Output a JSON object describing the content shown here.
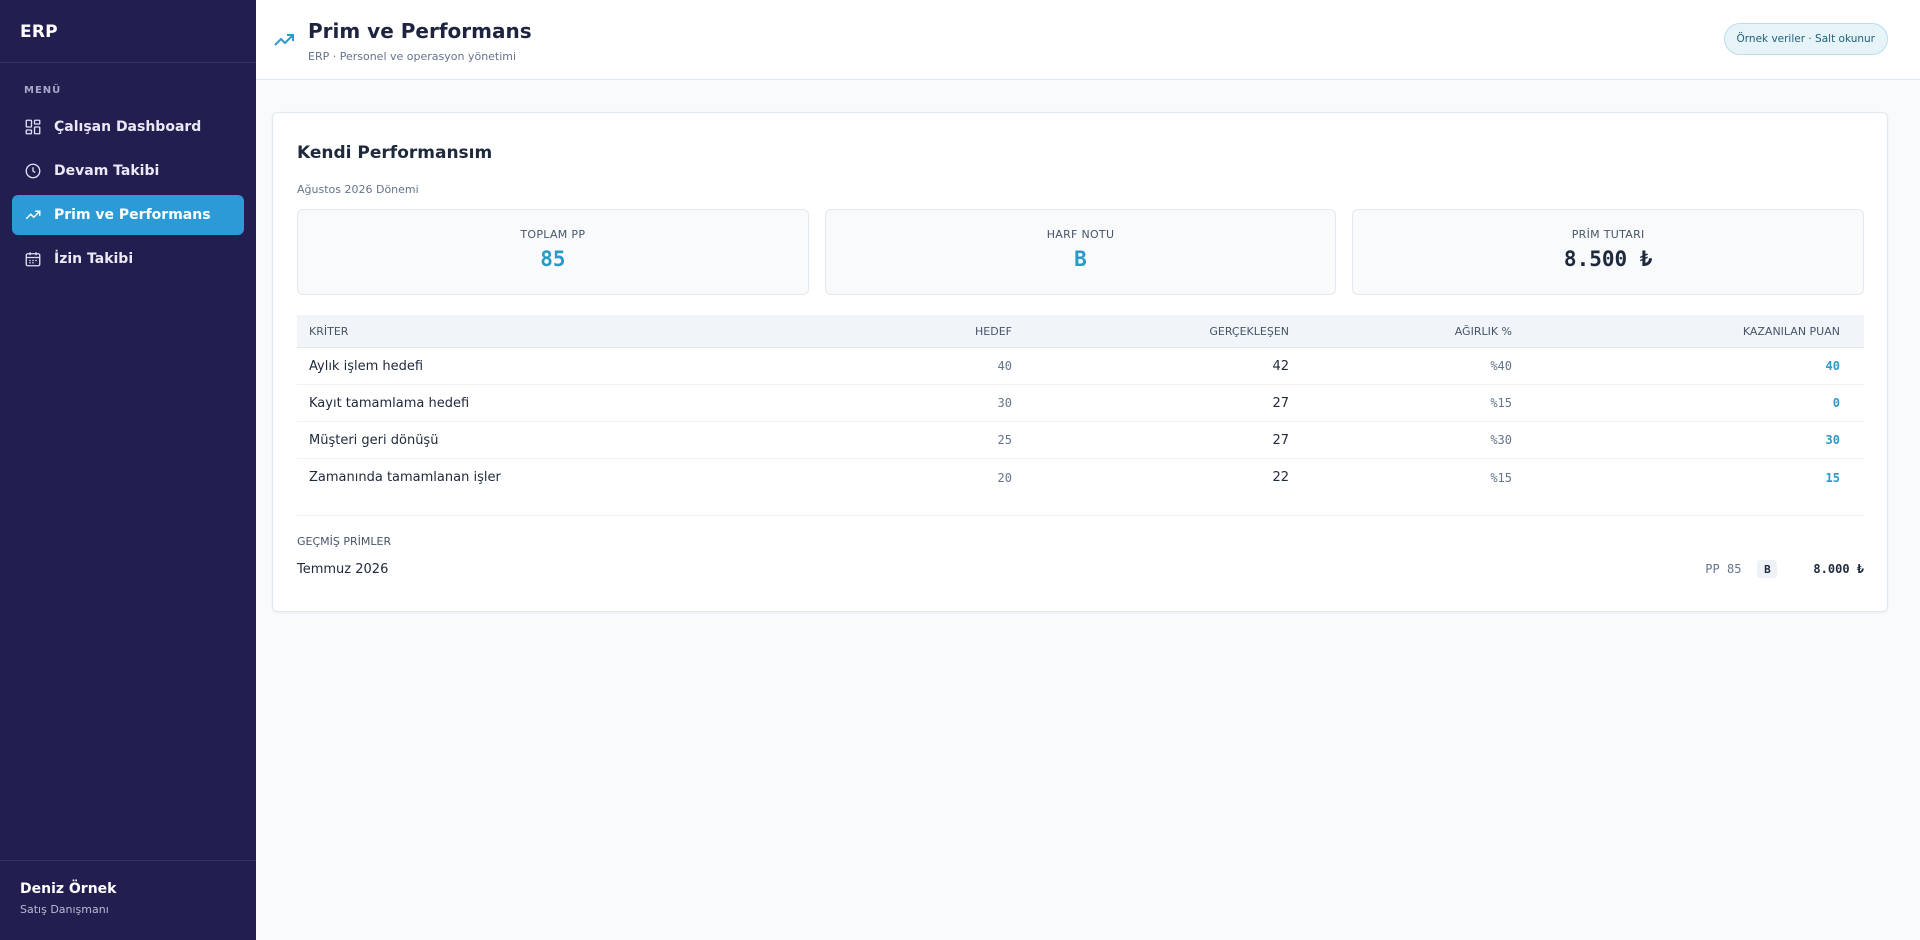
{
  "app": {
    "brand": "ERP"
  },
  "sidebar": {
    "menu_label": "MENÜ",
    "items": [
      {
        "label": "Çalışan Dashboard",
        "icon": "dashboard-icon",
        "active": false
      },
      {
        "label": "Devam Takibi",
        "icon": "clock-icon",
        "active": false
      },
      {
        "label": "Prim ve Performans",
        "icon": "trending-up-icon",
        "active": true
      },
      {
        "label": "İzin Takibi",
        "icon": "calendar-icon",
        "active": false
      }
    ],
    "user": {
      "name": "Deniz Örnek",
      "role": "Satış Danışmanı"
    }
  },
  "header": {
    "title": "Prim ve Performans",
    "subtitle": "ERP · Personel ve operasyon yönetimi",
    "badge": "Örnek veriler · Salt okunur"
  },
  "performance": {
    "title": "Kendi Performansım",
    "period": "Ağustos 2026 Dönemi",
    "stats": [
      {
        "label": "TOPLAM PP",
        "value": "85"
      },
      {
        "label": "HARF NOTU",
        "value": "B"
      },
      {
        "label": "PRİM TUTARI",
        "value": "8.500 ₺"
      }
    ],
    "table": {
      "headers": [
        "KRİTER",
        "HEDEF",
        "GERÇEKLEŞEN",
        "AĞIRLIK %",
        "KAZANILAN PUAN"
      ],
      "rows": [
        {
          "criterion": "Aylık işlem hedefi",
          "target": "40",
          "actual": "42",
          "weight": "%40",
          "points": "40"
        },
        {
          "criterion": "Kayıt tamamlama hedefi",
          "target": "30",
          "actual": "27",
          "weight": "%15",
          "points": "0"
        },
        {
          "criterion": "Müşteri geri dönüşü",
          "target": "25",
          "actual": "27",
          "weight": "%30",
          "points": "30"
        },
        {
          "criterion": "Zamanında tamamlanan işler",
          "target": "20",
          "actual": "22",
          "weight": "%15",
          "points": "15"
        }
      ]
    },
    "past": {
      "label": "GEÇMİŞ PRİMLER",
      "items": [
        {
          "period": "Temmuz 2026",
          "pp": "PP 85",
          "grade": "B",
          "amount": "8.000 ₺"
        }
      ]
    }
  },
  "colors": {
    "sidebar_bg": "#221e50",
    "accent": "#2b9ad6",
    "page_bg": "#f8fafc"
  }
}
